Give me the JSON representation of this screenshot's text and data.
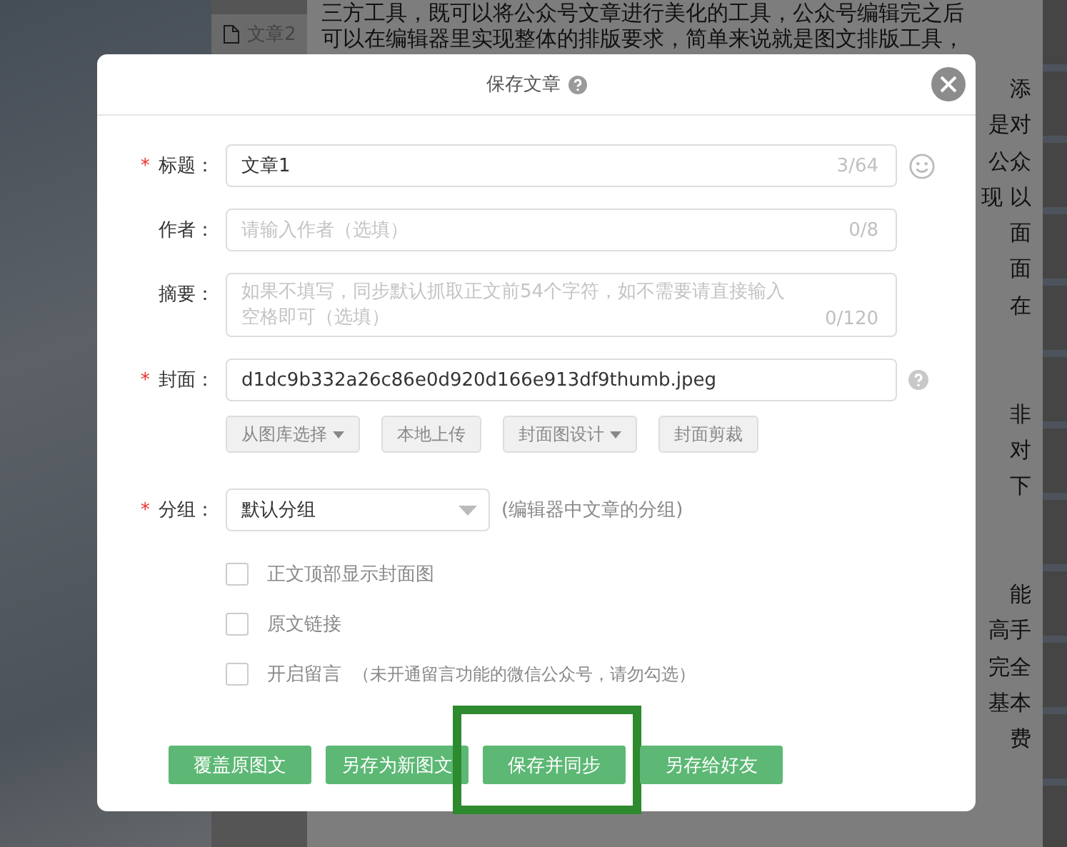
{
  "background": {
    "sidebar_tab": {
      "label": "文章2"
    },
    "article": [
      {
        "lines": [
          {
            "kind": "full",
            "text": "三方工具，既可以将公众号文章进行美化的工具，公众号编辑完之后"
          },
          {
            "kind": "full",
            "text": "可以在编辑器里实现整体的排版要求，简单来说就是图文排版工具，"
          },
          {
            "kind": "tail",
            "text": "添"
          },
          {
            "kind": "tail",
            "text": "是对"
          },
          {
            "kind": "tail",
            "text": "公众"
          },
          {
            "kind": "tail",
            "text": "现 以"
          },
          {
            "kind": "tail",
            "text": "面"
          },
          {
            "kind": "tail",
            "text": "面"
          },
          {
            "kind": "tail",
            "text": "在"
          }
        ]
      },
      {
        "lines": [
          {
            "kind": "tail",
            "text": "非"
          },
          {
            "kind": "tail",
            "text": "对"
          },
          {
            "kind": "tail",
            "text": "下"
          }
        ]
      },
      {
        "lines": [
          {
            "kind": "tail",
            "text": "能"
          },
          {
            "kind": "tail",
            "text": "高手"
          },
          {
            "kind": "tail",
            "text": "完全"
          },
          {
            "kind": "tail",
            "text": "基本"
          },
          {
            "kind": "tail",
            "text": "费"
          }
        ]
      }
    ]
  },
  "dialog": {
    "title": "保存文章",
    "fields": [
      {
        "kind": "input",
        "required_mark": "*",
        "label": "标题：",
        "value": "文章1",
        "counter": "3/64"
      },
      {
        "kind": "input",
        "label": "作者：",
        "placeholder": "请输入作者（选填）",
        "counter": "0/8"
      },
      {
        "kind": "textarea",
        "label": "摘要：",
        "placeholder": "如果不填写，同步默认抓取正文前54个字符，如不需要请直接输入空格即可（选填）",
        "counter": "0/120"
      },
      {
        "kind": "input",
        "required_mark": "*",
        "label": "封面：",
        "value": "d1dc9b332a26c86e0d920d166e913df9thumb.jpeg"
      }
    ],
    "cover_buttons": [
      {
        "label": "从图库选择",
        "dropdown": true
      },
      {
        "label": "本地上传",
        "dropdown": false
      },
      {
        "label": "封面图设计",
        "dropdown": true
      },
      {
        "label": "封面剪裁",
        "dropdown": false
      }
    ],
    "group": {
      "required_mark": "*",
      "label": "分组：",
      "value": "默认分组",
      "hint": "(编辑器中文章的分组)"
    },
    "checkboxes": [
      {
        "label": "正文顶部显示封面图",
        "checked": false
      },
      {
        "label": "原文链接",
        "checked": false
      },
      {
        "label": "开启留言",
        "checked": false,
        "note": "（未开通留言功能的微信公众号，请勿勾选）"
      }
    ],
    "buttons": [
      {
        "label": "覆盖原图文",
        "highlighted": false
      },
      {
        "label": "另存为新图文",
        "highlighted": false
      },
      {
        "label": "保存并同步",
        "highlighted": true
      },
      {
        "label": "另存给好友",
        "highlighted": false
      }
    ]
  }
}
